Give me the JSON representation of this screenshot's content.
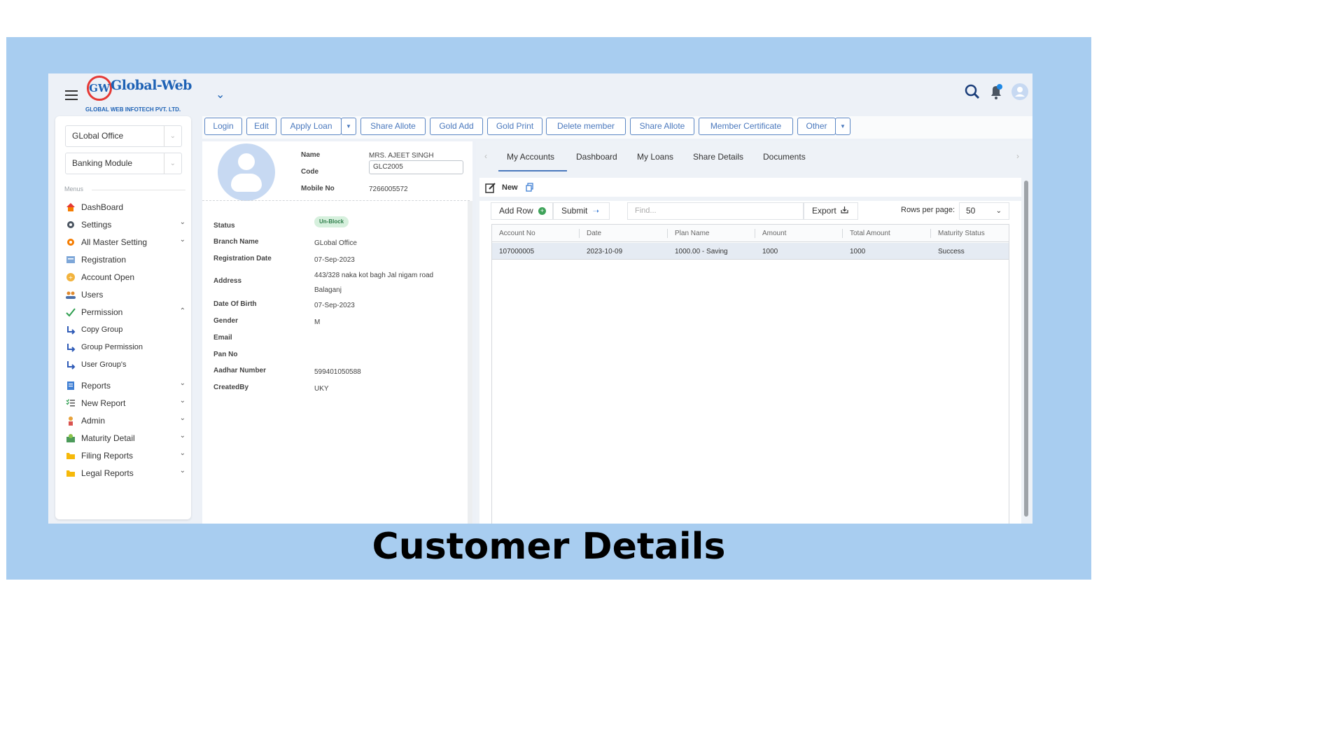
{
  "caption": "Customer Details",
  "header": {
    "logo_text": "Global-Web",
    "logo_mark": "GW",
    "logo_tagline": "GLOBAL WEB INFOTECH PVT. LTD.",
    "icons": [
      "search-icon",
      "notification-bell-icon",
      "user-avatar-icon"
    ]
  },
  "sidebar": {
    "office_select": "GLobal Office",
    "module_select": "Banking Module",
    "menus_label": "Menus",
    "items": [
      {
        "label": "DashBoard",
        "icon": "home-icon",
        "chevron": ""
      },
      {
        "label": "Settings",
        "icon": "gear-icon",
        "chevron": "down"
      },
      {
        "label": "All Master Setting",
        "icon": "master-gear-icon",
        "chevron": "down"
      },
      {
        "label": "Registration",
        "icon": "registration-icon",
        "chevron": ""
      },
      {
        "label": "Account Open",
        "icon": "account-open-icon",
        "chevron": ""
      },
      {
        "label": "Users",
        "icon": "users-icon",
        "chevron": ""
      },
      {
        "label": "Permission",
        "icon": "check-icon",
        "chevron": "up"
      },
      {
        "label": "Copy Group",
        "icon": "sub-arrow-icon",
        "chevron": ""
      },
      {
        "label": "Group Permission",
        "icon": "sub-arrow-icon",
        "chevron": ""
      },
      {
        "label": "User Group's",
        "icon": "sub-arrow-icon",
        "chevron": ""
      },
      {
        "label": "Reports",
        "icon": "report-icon",
        "chevron": "down"
      },
      {
        "label": "New Report",
        "icon": "checklist-icon",
        "chevron": "down"
      },
      {
        "label": "Admin",
        "icon": "admin-icon",
        "chevron": "down"
      },
      {
        "label": "Maturity Detail",
        "icon": "money-icon",
        "chevron": "down"
      },
      {
        "label": "Filing Reports",
        "icon": "folder-icon",
        "chevron": "down"
      },
      {
        "label": "Legal Reports",
        "icon": "folder-icon",
        "chevron": "down"
      }
    ]
  },
  "toolbar": {
    "login": "Login",
    "edit": "Edit",
    "apply_loan": "Apply Loan",
    "share_allote": "Share Allote",
    "gold_add": "Gold Add",
    "gold_print": "Gold Print",
    "delete_member": "Delete member",
    "share_allote_2": "Share Allote",
    "member_certificate": "Member Certificate",
    "other": "Other"
  },
  "profile": {
    "name_label": "Name",
    "name_value": "MRS. AJEET SINGH",
    "code_label": "Code",
    "code_value": "GLC2005",
    "mobile_label": "Mobile No",
    "mobile_value": "7266005572",
    "fields": {
      "status_label": "Status",
      "status_value": "Un-Block",
      "branch_label": "Branch Name",
      "branch_value": "GLobal Office",
      "reg_date_label": "Registration Date",
      "reg_date_value": "07-Sep-2023",
      "address_label": "Address",
      "address_line1": "443/328 naka kot bagh Jal nigam road",
      "address_line2": "Balaganj",
      "dob_label": "Date Of Birth",
      "dob_value": "07-Sep-2023",
      "gender_label": "Gender",
      "gender_value": "M",
      "email_label": "Email",
      "email_value": "",
      "pan_label": "Pan No",
      "pan_value": "",
      "aadhar_label": "Aadhar Number",
      "aadhar_value": "599401050588",
      "created_label": "CreatedBy",
      "created_value": "UKY"
    }
  },
  "tabs": {
    "my_accounts": "My Accounts",
    "dashboard": "Dashboard",
    "my_loans": "My Loans",
    "share_details": "Share Details",
    "documents": "Documents"
  },
  "actions": {
    "new_label": "New",
    "add_row": "Add Row",
    "submit": "Submit",
    "find_placeholder": "Find...",
    "export": "Export",
    "rows_per_page_label": "Rows per page:",
    "rows_per_page_value": "50"
  },
  "grid": {
    "columns": [
      "Account No",
      "Date",
      "Plan Name",
      "Amount",
      "Total Amount",
      "Maturity Status"
    ],
    "rows": [
      [
        "107000005",
        "2023-10-09",
        "1000.00 - Saving",
        "1000",
        "1000",
        "Success"
      ]
    ]
  },
  "colors": {
    "background": "#a8cdf0",
    "accent": "#4a78bd",
    "status_badge": "#d6f0dd"
  }
}
